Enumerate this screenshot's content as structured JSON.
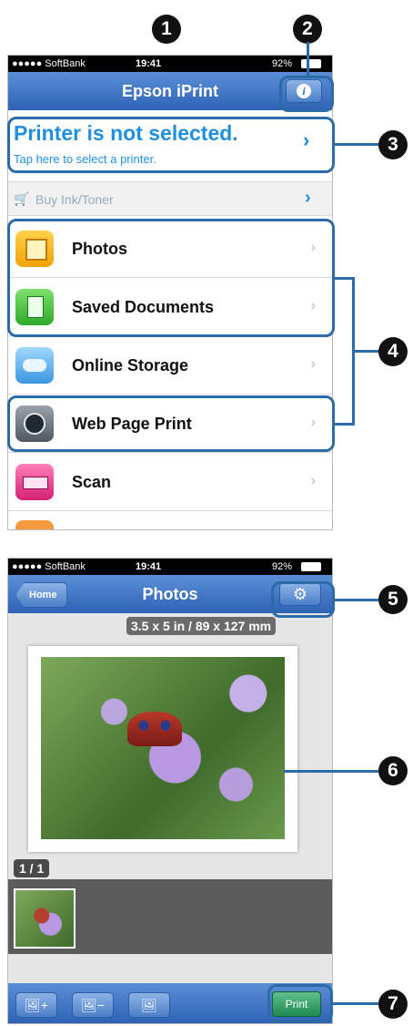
{
  "callouts": [
    "1",
    "2",
    "3",
    "4",
    "5",
    "6",
    "7"
  ],
  "screen1": {
    "status": {
      "carrier": "●●●●● SoftBank",
      "time": "19:41",
      "battery": "92%"
    },
    "title": "Epson iPrint",
    "info_icon": "info-icon",
    "printer": {
      "title": "Printer is not selected.",
      "subtitle": "Tap here to select a printer."
    },
    "buy_label": "Buy Ink/Toner",
    "menu": [
      {
        "label": "Photos",
        "icon": "photos-icon"
      },
      {
        "label": "Saved Documents",
        "icon": "document-icon"
      },
      {
        "label": "Online Storage",
        "icon": "cloud-icon"
      },
      {
        "label": "Web Page Print",
        "icon": "globe-icon"
      },
      {
        "label": "Scan",
        "icon": "scanner-icon"
      }
    ]
  },
  "screen2": {
    "status": {
      "carrier": "●●●●● SoftBank",
      "time": "19:41",
      "battery": "92%"
    },
    "home_label": "Home",
    "title": "Photos",
    "paper_size": "3.5 x 5 in / 89 x 127 mm",
    "page_counter": "1 / 1",
    "print_label": "Print"
  },
  "colors": {
    "accent": "#2c6aa8",
    "nav_blue": "#2f63b6",
    "link_blue": "#1f8fe0"
  }
}
